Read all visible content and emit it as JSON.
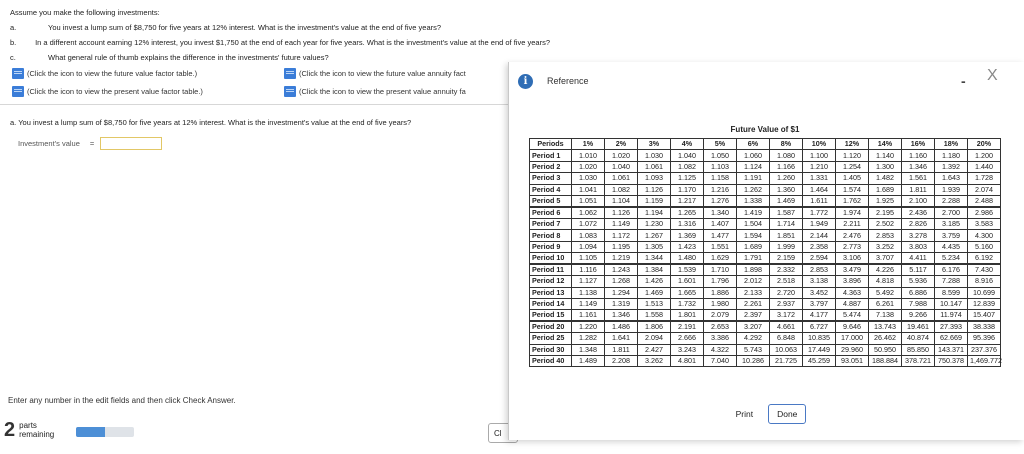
{
  "intro": "Assume you make the following investments:",
  "questions": [
    {
      "letter": "a.",
      "text": "You invest a lump sum of $8,750 for five years at 12% interest. What is the investment's value at the end of five years?"
    },
    {
      "letter": "b.",
      "text": "In a different account earning 12% interest, you invest $1,750 at the end of each year for five years. What is the investment's value at the end of five years?"
    },
    {
      "letter": "c.",
      "text": "What general rule of thumb explains the difference in the investments' future values?"
    }
  ],
  "links": {
    "fv_factor": "(Click the icon to view the future value factor table.)",
    "fv_annuity": "(Click the icon to view the future value annuity fact",
    "pv_factor": "(Click the icon to view the present value factor table.)",
    "pv_annuity": "(Click the icon to view the present value annuity fa"
  },
  "part_a": "a. You invest a lump sum of $8,750 for five years at 12% interest. What is the investment's value at the end of five years?",
  "answer": {
    "label": "Investment's value",
    "eq": "=",
    "value": ""
  },
  "footer": {
    "enter_msg": "Enter any number in the edit fields and then click Check Answer.",
    "parts_num": "2",
    "parts_line1": "parts",
    "parts_line2": "remaining",
    "progress": 0.5,
    "behind_button": "Cl"
  },
  "modal": {
    "title": "Reference",
    "minimize": "-",
    "close": "X",
    "table_title": "Future Value of $1",
    "headers": [
      "Periods",
      "1%",
      "2%",
      "3%",
      "4%",
      "5%",
      "6%",
      "8%",
      "10%",
      "12%",
      "14%",
      "16%",
      "18%",
      "20%"
    ],
    "groups": [
      [
        [
          "Period 1",
          "1.010",
          "1.020",
          "1.030",
          "1.040",
          "1.050",
          "1.060",
          "1.080",
          "1.100",
          "1.120",
          "1.140",
          "1.160",
          "1.180",
          "1.200"
        ],
        [
          "Period 2",
          "1.020",
          "1.040",
          "1.061",
          "1.082",
          "1.103",
          "1.124",
          "1.166",
          "1.210",
          "1.254",
          "1.300",
          "1.346",
          "1.392",
          "1.440"
        ],
        [
          "Period 3",
          "1.030",
          "1.061",
          "1.093",
          "1.125",
          "1.158",
          "1.191",
          "1.260",
          "1.331",
          "1.405",
          "1.482",
          "1.561",
          "1.643",
          "1.728"
        ],
        [
          "Period 4",
          "1.041",
          "1.082",
          "1.126",
          "1.170",
          "1.216",
          "1.262",
          "1.360",
          "1.464",
          "1.574",
          "1.689",
          "1.811",
          "1.939",
          "2.074"
        ],
        [
          "Period 5",
          "1.051",
          "1.104",
          "1.159",
          "1.217",
          "1.276",
          "1.338",
          "1.469",
          "1.611",
          "1.762",
          "1.925",
          "2.100",
          "2.288",
          "2.488"
        ]
      ],
      [
        [
          "Period 6",
          "1.062",
          "1.126",
          "1.194",
          "1.265",
          "1.340",
          "1.419",
          "1.587",
          "1.772",
          "1.974",
          "2.195",
          "2.436",
          "2.700",
          "2.986"
        ],
        [
          "Period 7",
          "1.072",
          "1.149",
          "1.230",
          "1.316",
          "1.407",
          "1.504",
          "1.714",
          "1.949",
          "2.211",
          "2.502",
          "2.826",
          "3.185",
          "3.583"
        ],
        [
          "Period 8",
          "1.083",
          "1.172",
          "1.267",
          "1.369",
          "1.477",
          "1.594",
          "1.851",
          "2.144",
          "2.476",
          "2.853",
          "3.278",
          "3.759",
          "4.300"
        ],
        [
          "Period 9",
          "1.094",
          "1.195",
          "1.305",
          "1.423",
          "1.551",
          "1.689",
          "1.999",
          "2.358",
          "2.773",
          "3.252",
          "3.803",
          "4.435",
          "5.160"
        ],
        [
          "Period 10",
          "1.105",
          "1.219",
          "1.344",
          "1.480",
          "1.629",
          "1.791",
          "2.159",
          "2.594",
          "3.106",
          "3.707",
          "4.411",
          "5.234",
          "6.192"
        ]
      ],
      [
        [
          "Period 11",
          "1.116",
          "1.243",
          "1.384",
          "1.539",
          "1.710",
          "1.898",
          "2.332",
          "2.853",
          "3.479",
          "4.226",
          "5.117",
          "6.176",
          "7.430"
        ],
        [
          "Period 12",
          "1.127",
          "1.268",
          "1.426",
          "1.601",
          "1.796",
          "2.012",
          "2.518",
          "3.138",
          "3.896",
          "4.818",
          "5.936",
          "7.288",
          "8.916"
        ],
        [
          "Period 13",
          "1.138",
          "1.294",
          "1.469",
          "1.665",
          "1.886",
          "2.133",
          "2.720",
          "3.452",
          "4.363",
          "5.492",
          "6.886",
          "8.599",
          "10.699"
        ],
        [
          "Period 14",
          "1.149",
          "1.319",
          "1.513",
          "1.732",
          "1.980",
          "2.261",
          "2.937",
          "3.797",
          "4.887",
          "6.261",
          "7.988",
          "10.147",
          "12.839"
        ],
        [
          "Period 15",
          "1.161",
          "1.346",
          "1.558",
          "1.801",
          "2.079",
          "2.397",
          "3.172",
          "4.177",
          "5.474",
          "7.138",
          "9.266",
          "11.974",
          "15.407"
        ]
      ],
      [
        [
          "Period 20",
          "1.220",
          "1.486",
          "1.806",
          "2.191",
          "2.653",
          "3.207",
          "4.661",
          "6.727",
          "9.646",
          "13.743",
          "19.461",
          "27.393",
          "38.338"
        ],
        [
          "Period 25",
          "1.282",
          "1.641",
          "2.094",
          "2.666",
          "3.386",
          "4.292",
          "6.848",
          "10.835",
          "17.000",
          "26.462",
          "40.874",
          "62.669",
          "95.396"
        ],
        [
          "Period 30",
          "1.348",
          "1.811",
          "2.427",
          "3.243",
          "4.322",
          "5.743",
          "10.063",
          "17.449",
          "29.960",
          "50.950",
          "85.850",
          "143.371",
          "237.376"
        ],
        [
          "Period 40",
          "1.489",
          "2.208",
          "3.262",
          "4.801",
          "7.040",
          "10.286",
          "21.725",
          "45.259",
          "93.051",
          "188.884",
          "378.721",
          "750.378",
          "1,469.772"
        ]
      ]
    ],
    "print_label": "Print",
    "done_label": "Done"
  }
}
